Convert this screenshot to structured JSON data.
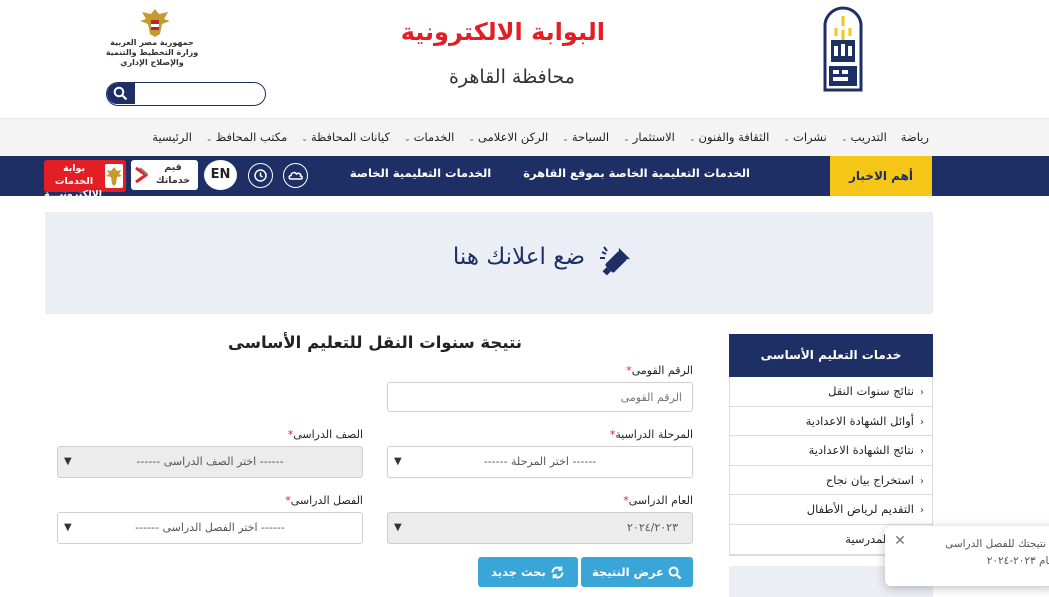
{
  "header": {
    "title": "البوابة الالكترونية",
    "subtitle": "محافظة القاهرة",
    "gov_line1": "جمهورية مصر العربية",
    "gov_line2": "وزارة التخطيط والتنمية والإصلاح الإداري",
    "search_placeholder": ""
  },
  "nav": {
    "items": [
      {
        "label": "الرئيسية",
        "dropdown": false
      },
      {
        "label": "مكتب المحافظ",
        "dropdown": true
      },
      {
        "label": "كيانات المحافظة",
        "dropdown": true
      },
      {
        "label": "الخدمات",
        "dropdown": true
      },
      {
        "label": "الركن الاعلامى",
        "dropdown": true
      },
      {
        "label": "السياحة",
        "dropdown": true
      },
      {
        "label": "الاستثمار",
        "dropdown": true
      },
      {
        "label": "الثقافة والفنون",
        "dropdown": true
      },
      {
        "label": "نشرات",
        "dropdown": true
      },
      {
        "label": "التدريب",
        "dropdown": true
      },
      {
        "label": "رياضة",
        "dropdown": false
      }
    ]
  },
  "newsbar": {
    "label": "أهم الاخبار",
    "items": [
      "الخدمات التعليمية الخاصة بموقع القاهرة",
      "الخدمات التعليمية الخاصة بمر"
    ],
    "en_label": "EN",
    "qayem_label": "قيم خدماتك",
    "egov_label": "بوابة الخدمات الإلكترونيـــة"
  },
  "ad": {
    "text": "ضع اعلانك هنا"
  },
  "sidebar": {
    "title": "خدمات التعليم الأساسى",
    "items": [
      "نتائج سنوات النقل",
      "أوائل الشهادة الاعدادية",
      "نتائج الشهادة الاعدادية",
      "استخراج بيان نجاح",
      "التقديم لرياض الأطفال",
      "يلات المدرسية"
    ]
  },
  "form": {
    "title": "نتيجة سنوات النقل للتعليم الأساسى",
    "required_mark": "*",
    "national_id_label": "الرقم القومى",
    "national_id_placeholder": "الرقم القومى",
    "stage_label": "المرحلة الدراسية",
    "stage_value": "------ اختر المرحلة ------",
    "grade_label": "الصف الدراسى",
    "grade_value": "------ اختر الصف الدراسى ------",
    "year_label": "العام الدراسى",
    "year_value": "٢٠٢٤/٢٠٢٣",
    "term_label": "الفصل الدراسى",
    "term_value": "------ اختر الفصل الدراسى ------",
    "show_result_label": "عرض النتيجة",
    "new_search_label": "بحث جديد"
  },
  "toast": {
    "line1": "٥ نتيجتك للفصل الدراسى",
    "line2": "عام ٢٠٢٣-٢٠٢٤"
  },
  "colors": {
    "navy": "#1e2f66",
    "red": "#e31e24",
    "yellow": "#f5c518",
    "button_blue": "#3aa6d8"
  }
}
